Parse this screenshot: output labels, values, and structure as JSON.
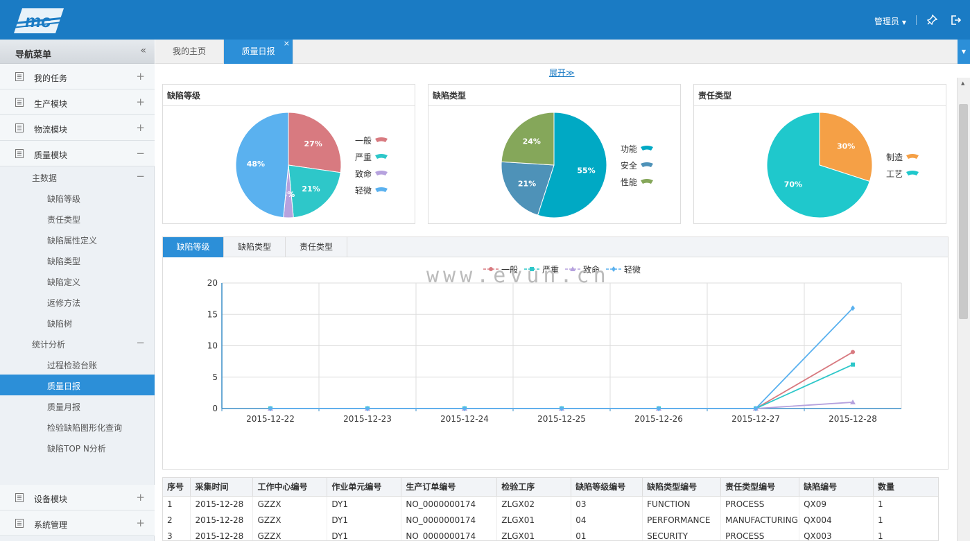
{
  "header": {
    "logo_text": "mc",
    "user": "管理员"
  },
  "sidebar": {
    "title": "导航菜单",
    "modules": [
      {
        "label": "我的任务",
        "toggle": "+"
      },
      {
        "label": "生产模块",
        "toggle": "+"
      },
      {
        "label": "物流模块",
        "toggle": "+"
      },
      {
        "label": "质量模块",
        "toggle": "−"
      }
    ],
    "groups": [
      {
        "label": "主数据",
        "toggle": "−",
        "items": [
          "缺陷等级",
          "责任类型",
          "缺陷属性定义",
          "缺陷类型",
          "缺陷定义",
          "返修方法",
          "缺陷树"
        ]
      },
      {
        "label": "统计分析",
        "toggle": "−",
        "items": [
          "过程检验台账",
          "质量日报",
          "质量月报",
          "检验缺陷图形化查询",
          "缺陷TOP N分析"
        ]
      }
    ],
    "bottom_modules": [
      {
        "label": "设备模块",
        "toggle": "+"
      },
      {
        "label": "系统管理",
        "toggle": "+"
      }
    ]
  },
  "tabs": [
    {
      "label": "我的主页"
    },
    {
      "label": "质量日报"
    }
  ],
  "expand_label": "展开",
  "pie_panels": [
    {
      "title": "缺陷等级",
      "slices": [
        {
          "name": "一般",
          "value": 27,
          "color": "#d87a80"
        },
        {
          "name": "严重",
          "value": 21,
          "color": "#2ec7c9"
        },
        {
          "name": "致命",
          "value": 3,
          "color": "#b6a2de"
        },
        {
          "name": "轻微",
          "value": 48,
          "color": "#5ab1ef"
        }
      ]
    },
    {
      "title": "缺陷类型",
      "slices": [
        {
          "name": "功能",
          "value": 55,
          "color": "#00a9c4"
        },
        {
          "name": "安全",
          "value": 21,
          "color": "#4e92b8"
        },
        {
          "name": "性能",
          "value": 24,
          "color": "#85a75a"
        }
      ]
    },
    {
      "title": "责任类型",
      "slices": [
        {
          "name": "制造",
          "value": 30,
          "color": "#f5a046"
        },
        {
          "name": "工艺",
          "value": 70,
          "color": "#1fc8cc"
        }
      ]
    }
  ],
  "line_tabs": [
    "缺陷等级",
    "缺陷类型",
    "责任类型"
  ],
  "watermark": "www.evun.cn",
  "chart_data": {
    "type": "line",
    "x": [
      "2015-12-22",
      "2015-12-23",
      "2015-12-24",
      "2015-12-25",
      "2015-12-26",
      "2015-12-27",
      "2015-12-28"
    ],
    "ylim": [
      0,
      20
    ],
    "yticks": [
      0,
      5,
      10,
      15,
      20
    ],
    "grid": true,
    "legend": "top-center",
    "series": [
      {
        "name": "一般",
        "values": [
          0,
          0,
          0,
          0,
          0,
          0,
          9
        ],
        "color": "#d87a80",
        "marker": "circle"
      },
      {
        "name": "严重",
        "values": [
          0,
          0,
          0,
          0,
          0,
          0,
          7
        ],
        "color": "#2ec7c9",
        "marker": "square"
      },
      {
        "name": "致命",
        "values": [
          0,
          0,
          0,
          0,
          0,
          0,
          1
        ],
        "color": "#b6a2de",
        "marker": "triangle"
      },
      {
        "name": "轻微",
        "values": [
          0,
          0,
          0,
          0,
          0,
          0,
          16
        ],
        "color": "#5ab1ef",
        "marker": "diamond"
      }
    ]
  },
  "table": {
    "headers": [
      "序号",
      "采集时间",
      "工作中心编号",
      "作业单元编号",
      "生产订单编号",
      "检验工序",
      "缺陷等级编号",
      "缺陷类型编号",
      "责任类型编号",
      "缺陷编号",
      "数量"
    ],
    "rows": [
      [
        "1",
        "2015-12-28",
        "GZZX",
        "DY1",
        "NO_0000000174",
        "ZLGX02",
        "03",
        "FUNCTION",
        "PROCESS",
        "QX09",
        "1"
      ],
      [
        "2",
        "2015-12-28",
        "GZZX",
        "DY1",
        "NO_0000000174",
        "ZLGX01",
        "04",
        "PERFORMANCE",
        "MANUFACTURING",
        "QX004",
        "1"
      ],
      [
        "3",
        "2015-12-28",
        "GZZX",
        "DY1",
        "NO_0000000174",
        "ZLGX01",
        "01",
        "SECURITY",
        "PROCESS",
        "QX003",
        "1"
      ]
    ]
  }
}
